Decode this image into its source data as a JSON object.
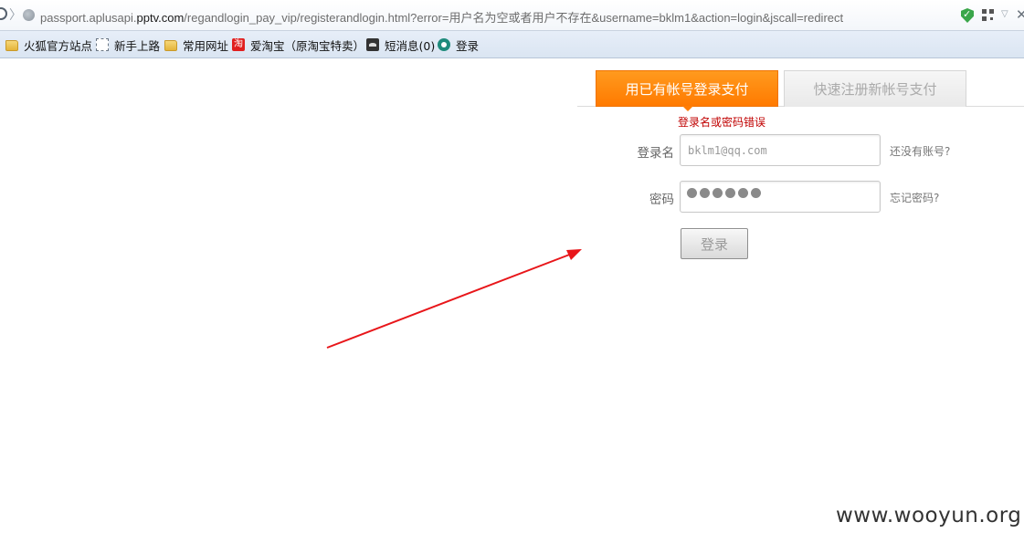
{
  "browser": {
    "url_prefix": "passport.aplusapi.",
    "url_domain": "pptv.com",
    "url_suffix": "/regandlogin_pay_vip/registerandlogin.html?error=用户名为空或者用户不存在&username=bklm1&action=login&jscall=redirect",
    "bookmarks": [
      {
        "label": "火狐官方站点",
        "icon": "folder-icon"
      },
      {
        "label": "新手上路",
        "icon": "page-icon"
      },
      {
        "label": "常用网址",
        "icon": "folder-icon"
      },
      {
        "label": "爱淘宝（原淘宝特卖）",
        "icon": "taobao-icon"
      },
      {
        "label": "短消息(0)",
        "icon": "message-icon"
      },
      {
        "label": "登录",
        "icon": "pptv-icon"
      }
    ]
  },
  "login": {
    "tab_login": "用已有帐号登录支付",
    "tab_register": "快速注册新帐号支付",
    "error": "登录名或密码错误",
    "username_label": "登录名",
    "username_value": "bklm1@qq.com",
    "password_label": "密码",
    "password_masked_count": 6,
    "no_account_link": "还没有账号?",
    "forgot_link": "忘记密码?",
    "submit": "登录"
  },
  "annotation": {
    "arrow_color": "#e8161a"
  },
  "watermark": "www.wooyun.org"
}
